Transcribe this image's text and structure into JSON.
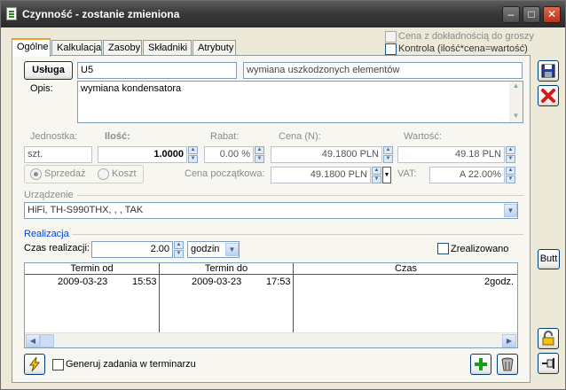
{
  "window": {
    "title": "Czynność - zostanie zmieniona"
  },
  "tabs": [
    {
      "label": "Ogólne"
    },
    {
      "label": "Kalkulacja"
    },
    {
      "label": "Zasoby"
    },
    {
      "label": "Składniki"
    },
    {
      "label": "Atrybuty"
    }
  ],
  "options": {
    "precision_label": "Cena z dokładnością do groszy",
    "control_label": "Kontrola (ilość*cena=wartość)"
  },
  "service": {
    "button_label": "Usługa",
    "code": "U5",
    "name": "wymiana uszkodzonych elementów",
    "description_label": "Opis:",
    "description": "wymiana kondensatora"
  },
  "fields": {
    "unit_label": "Jednostka:",
    "unit_value": "szt.",
    "quantity_label": "Ilość:",
    "quantity_value": "1.0000",
    "discount_label": "Rabat:",
    "discount_value": "0.00 %",
    "price_label": "Cena (N):",
    "price_value": "49.1800 PLN",
    "value_label": "Wartość:",
    "value_value": "49.18 PLN",
    "sale_label": "Sprzedaż",
    "cost_label": "Koszt",
    "initial_price_label": "Cena początkowa:",
    "initial_price_value": "49.1800 PLN",
    "vat_label": "VAT:",
    "vat_value": "A 22.00%"
  },
  "device": {
    "label": "Urządzenie",
    "value": "HiFi, TH-S990THX, , , TAK"
  },
  "realization": {
    "label": "Realizacja",
    "time_label": "Czas realizacji:",
    "time_value": "2.00",
    "unit": "godzin",
    "done_label": "Zrealizowano",
    "columns": [
      "Termin od",
      "Termin do",
      "Czas"
    ],
    "rows": [
      {
        "from_date": "2009-03-23",
        "from_time": "15:53",
        "to_date": "2009-03-23",
        "to_time": "17:53",
        "duration": "2godz."
      }
    ],
    "generate_label": "Generuj zadania w terminarzu"
  },
  "side": {
    "butt_label": "Butt"
  }
}
